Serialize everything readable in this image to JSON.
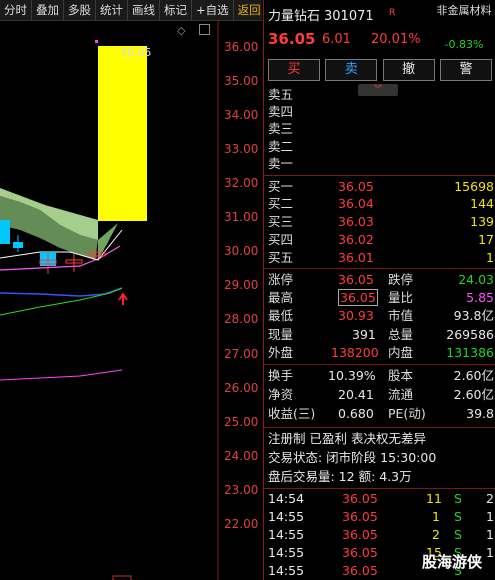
{
  "toolbar": {
    "items": [
      "分时",
      "叠加",
      "多股",
      "统计",
      "画线",
      "标记",
      "+自选",
      "返回"
    ]
  },
  "chart": {
    "y_ticks": [
      "36.00",
      "35.00",
      "34.00",
      "33.00",
      "32.00",
      "31.00",
      "30.00",
      "29.00",
      "28.00",
      "27.00",
      "26.00",
      "25.00",
      "24.00",
      "23.00",
      "22.00"
    ],
    "high_label": "36.05",
    "colors": {
      "up": "#ff3b3b",
      "down": "#00c8ff",
      "cloud": "#b7e39a",
      "highlight": "#ffff00"
    }
  },
  "header": {
    "name": "力量钻石",
    "code": "301071",
    "tag": "R",
    "sector": "非金属材料",
    "sector_change": "-0.83%",
    "price": "36.05",
    "change": "6.01",
    "pct": "20.01%"
  },
  "buttons": {
    "buy": "买",
    "sell": "卖",
    "cancel": "撤",
    "alert": "警"
  },
  "ask": [
    {
      "label": "卖五",
      "price": "",
      "vol": ""
    },
    {
      "label": "卖四",
      "price": "",
      "vol": ""
    },
    {
      "label": "卖三",
      "price": "",
      "vol": ""
    },
    {
      "label": "卖二",
      "price": "",
      "vol": ""
    },
    {
      "label": "卖一",
      "price": "",
      "vol": ""
    }
  ],
  "bid": [
    {
      "label": "买一",
      "price": "36.05",
      "vol": "15698"
    },
    {
      "label": "买二",
      "price": "36.04",
      "vol": "144"
    },
    {
      "label": "买三",
      "price": "36.03",
      "vol": "139"
    },
    {
      "label": "买四",
      "price": "36.02",
      "vol": "17"
    },
    {
      "label": "买五",
      "price": "36.01",
      "vol": "1"
    }
  ],
  "stats": {
    "limit_up_label": "涨停",
    "limit_up": "36.05",
    "limit_down_label": "跌停",
    "limit_down": "24.03",
    "high_label": "最高",
    "high": "36.05",
    "vol_ratio_label": "量比",
    "vol_ratio": "5.85",
    "low_label": "最低",
    "low": "30.93",
    "mktcap_label": "市值",
    "mktcap": "93.8亿",
    "cur_vol_label": "现量",
    "cur_vol": "391",
    "total_vol_label": "总量",
    "total_vol": "269586",
    "outer_label": "外盘",
    "outer": "138200",
    "inner_label": "内盘",
    "inner": "131386"
  },
  "fund": {
    "turnover_label": "换手",
    "turnover": "10.39%",
    "equity_label": "股本",
    "equity": "2.60亿",
    "nav_label": "净资",
    "nav": "20.41",
    "float_label": "流通",
    "float": "2.60亿",
    "eps_label": "收益(三)",
    "eps": "0.680",
    "pe_label": "PE(动)",
    "pe": "39.8"
  },
  "info": {
    "flags": "注册制 已盈利 表决权无差异",
    "status": "交易状态: 闭市阶段 15:30:00",
    "after_hours": "盘后交易量: 12  额: 4.3万"
  },
  "ticks": [
    {
      "time": "14:54",
      "price": "36.05",
      "vol": "11",
      "side": "S",
      "n": "2"
    },
    {
      "time": "14:55",
      "price": "36.05",
      "vol": "1",
      "side": "S",
      "n": "1"
    },
    {
      "time": "14:55",
      "price": "36.05",
      "vol": "2",
      "side": "S",
      "n": "1"
    },
    {
      "time": "14:55",
      "price": "36.05",
      "vol": "15",
      "side": "S",
      "n": "1"
    },
    {
      "time": "14:55",
      "price": "36.05",
      "vol": "",
      "side": "S",
      "n": ""
    }
  ],
  "brand": "股海游侠"
}
